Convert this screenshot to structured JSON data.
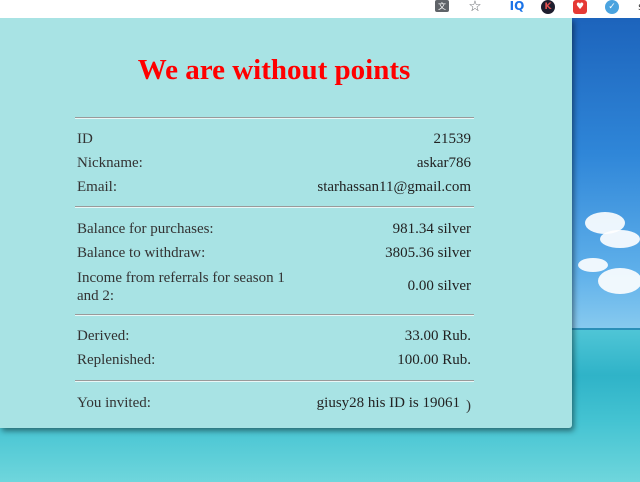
{
  "toolbar": {
    "icons": [
      "translate-icon",
      "star-icon",
      "iq-extension-icon",
      "k-extension-icon",
      "heart-extension-icon",
      "blue-extension-icon",
      "s-extension-icon"
    ],
    "iq_text": "IQ",
    "k_text": "K",
    "s_text": "s"
  },
  "panel": {
    "title": "We are without points",
    "title_color": "#ff0000",
    "background": "#a8e3e4",
    "account": {
      "id_label": "ID",
      "id_value": "21539",
      "nickname_label": "Nickname:",
      "nickname_value": "askar786",
      "email_label": "Email:",
      "email_value": "starhassan11@gmail.com"
    },
    "balances": {
      "purchases_label": "Balance for purchases:",
      "purchases_value": "981.34 silver",
      "withdraw_label": "Balance to withdraw:",
      "withdraw_value": "3805.36 silver",
      "referral_label": "Income from referrals for season 1 and 2:",
      "referral_value": "0.00 silver"
    },
    "money": {
      "derived_label": "Derived:",
      "derived_value": "33.00 Rub.",
      "replenished_label": "Replenished:",
      "replenished_value": "100.00 Rub."
    },
    "invited": {
      "label": "You invited:",
      "value": "giusy28 his ID is 19061"
    }
  }
}
